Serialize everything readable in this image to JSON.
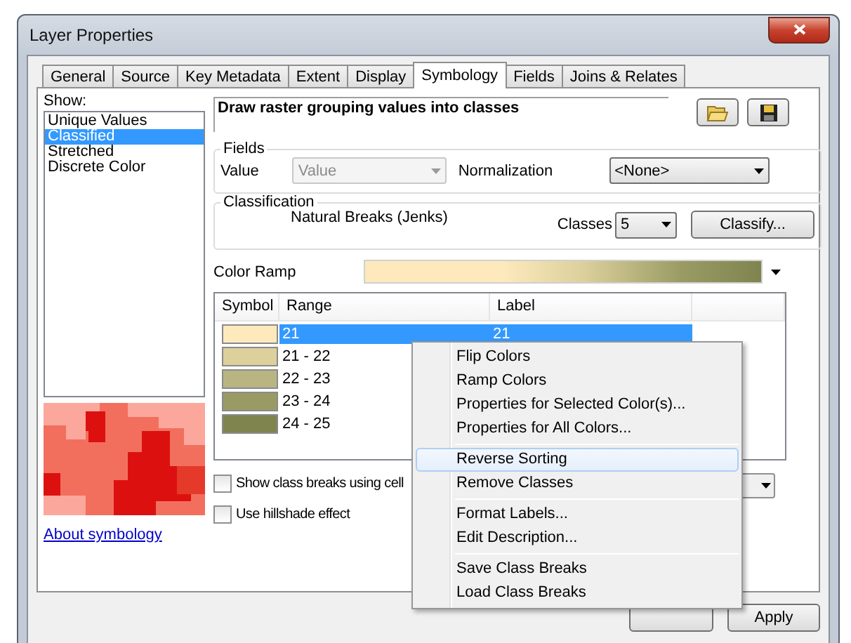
{
  "window": {
    "title": "Layer Properties"
  },
  "tabs": [
    {
      "label": "General",
      "selected": false
    },
    {
      "label": "Source",
      "selected": false
    },
    {
      "label": "Key Metadata",
      "selected": false
    },
    {
      "label": "Extent",
      "selected": false
    },
    {
      "label": "Display",
      "selected": false
    },
    {
      "label": "Symbology",
      "selected": true
    },
    {
      "label": "Fields",
      "selected": false
    },
    {
      "label": "Joins & Relates",
      "selected": false
    }
  ],
  "show": {
    "label": "Show:",
    "items": [
      {
        "label": "Unique Values",
        "selected": false
      },
      {
        "label": "Classified",
        "selected": true
      },
      {
        "label": "Stretched",
        "selected": false
      },
      {
        "label": "Discrete Color",
        "selected": false
      }
    ]
  },
  "about_link": "About symbology",
  "description": "Draw raster grouping values into classes",
  "fields": {
    "legend": "Fields",
    "value_label": "Value",
    "value": "Value",
    "value_disabled": true,
    "normalization_label": "Normalization",
    "normalization": "<None>"
  },
  "classification": {
    "legend": "Classification",
    "method": "Natural Breaks (Jenks)",
    "classes_label": "Classes",
    "classes": "5",
    "classify_button": "Classify..."
  },
  "color_ramp": {
    "label": "Color Ramp"
  },
  "table": {
    "columns": [
      "Symbol",
      "Range",
      "Label"
    ],
    "rows": [
      {
        "color": "#fde9bc",
        "range": "21",
        "label": "21",
        "selected": true
      },
      {
        "color": "#dcd09c",
        "range": "21 - 22",
        "selected": false
      },
      {
        "color": "#b9b583",
        "range": "22 - 23",
        "selected": false
      },
      {
        "color": "#9a9b64",
        "range": "23 - 24",
        "selected": false
      },
      {
        "color": "#7f844f",
        "range": "24 - 25",
        "selected": false
      }
    ]
  },
  "checkboxes": [
    {
      "label": "Show class breaks using cell",
      "checked": false
    },
    {
      "label": "Use hillshade effect",
      "checked": false
    }
  ],
  "context_menu": [
    {
      "kind": "item",
      "label": "Flip Colors",
      "selected": false
    },
    {
      "kind": "item",
      "label": "Ramp Colors",
      "selected": false
    },
    {
      "kind": "item",
      "label": "Properties for Selected Color(s)...",
      "selected": false
    },
    {
      "kind": "item",
      "label": "Properties for All Colors...",
      "selected": false
    },
    {
      "kind": "separator"
    },
    {
      "kind": "item",
      "label": "Reverse Sorting",
      "selected": true
    },
    {
      "kind": "item",
      "label": "Remove Classes",
      "selected": false
    },
    {
      "kind": "separator"
    },
    {
      "kind": "item",
      "label": "Format Labels...",
      "selected": false
    },
    {
      "kind": "item",
      "label": "Edit Description...",
      "selected": false
    },
    {
      "kind": "separator"
    },
    {
      "kind": "item",
      "label": "Save Class Breaks",
      "selected": false
    },
    {
      "kind": "item",
      "label": "Load Class Breaks",
      "selected": false
    }
  ],
  "buttons": [
    "Apply"
  ]
}
